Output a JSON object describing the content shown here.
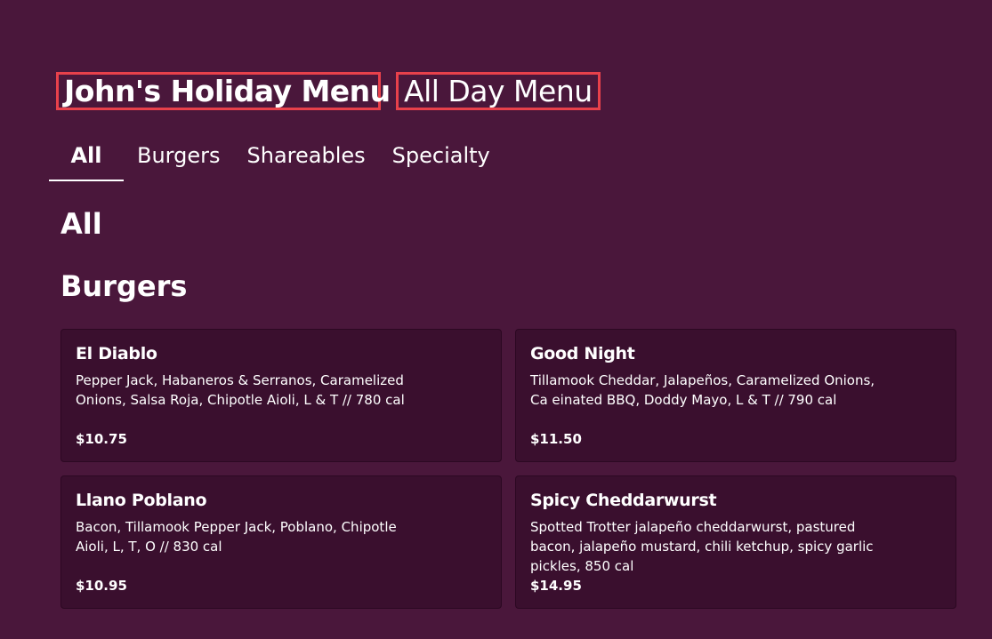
{
  "menus": [
    {
      "label": "John's Holiday Menu"
    },
    {
      "label": "All Day Menu"
    }
  ],
  "tabs": [
    {
      "label": "All"
    },
    {
      "label": "Burgers"
    },
    {
      "label": "Shareables"
    },
    {
      "label": "Specialty"
    }
  ],
  "sections": {
    "all_title": "All",
    "burgers_title": "Burgers"
  },
  "items": [
    {
      "name": "El Diablo",
      "description": "Pepper Jack, Habaneros & Serranos, Caramelized Onions, Salsa Roja, Chipotle Aioli, L & T // 780 cal",
      "price": "$10.75"
    },
    {
      "name": "Good Night",
      "description": "Tillamook Cheddar, Jalapeños, Caramelized Onions, Ca einated BBQ, Doddy Mayo, L & T // 790 cal",
      "price": "$11.50"
    },
    {
      "name": "Llano Poblano",
      "description": "Bacon, Tillamook Pepper Jack, Poblano, Chipotle Aioli, L, T, O // 830 cal",
      "price": "$10.95"
    },
    {
      "name": "Spicy Cheddarwurst",
      "description": "Spotted Trotter jalapeño cheddarwurst, pastured bacon, jalapeño mustard, chili ketchup, spicy garlic pickles, 850 cal",
      "price": "$14.95"
    }
  ],
  "colors": {
    "background": "#4a173b",
    "card": "#3a0f2e",
    "highlight_border": "#e8414b"
  }
}
